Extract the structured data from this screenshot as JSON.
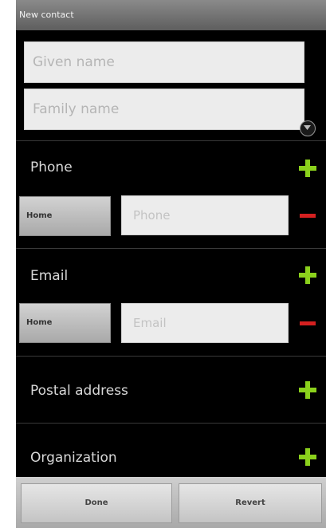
{
  "window": {
    "title": "New contact"
  },
  "name": {
    "given_placeholder": "Given name",
    "family_placeholder": "Family name",
    "expand_icon": "chevron-down-circle-icon"
  },
  "phone": {
    "label": "Phone",
    "type_label": "Home",
    "placeholder": "Phone"
  },
  "email": {
    "label": "Email",
    "type_label": "Home",
    "placeholder": "Email"
  },
  "postal": {
    "label": "Postal address"
  },
  "organization": {
    "label": "Organization"
  },
  "actions": {
    "done_label": "Done",
    "revert_label": "Revert"
  },
  "colors": {
    "add": "#8bd11c",
    "remove": "#d42020",
    "background": "#000000"
  }
}
